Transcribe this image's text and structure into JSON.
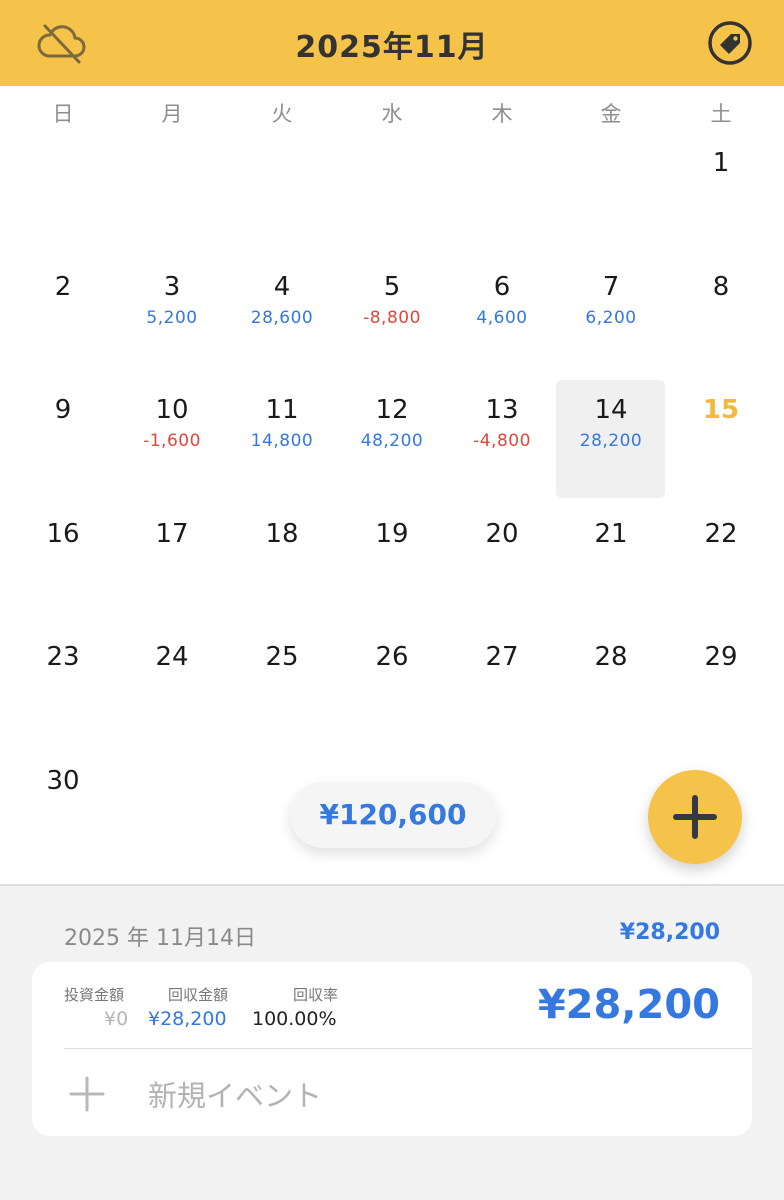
{
  "header": {
    "title": "2025年11月",
    "left_icon": "cloud-off-icon",
    "right_icon": "tag-icon"
  },
  "weekdays": [
    "日",
    "月",
    "火",
    "水",
    "木",
    "金",
    "土"
  ],
  "days": {
    "d1": {
      "num": "1",
      "amt": ""
    },
    "d2": {
      "num": "2",
      "amt": ""
    },
    "d3": {
      "num": "3",
      "amt": "5,200"
    },
    "d4": {
      "num": "4",
      "amt": "28,600"
    },
    "d5": {
      "num": "5",
      "amt": "-8,800"
    },
    "d6": {
      "num": "6",
      "amt": "4,600"
    },
    "d7": {
      "num": "7",
      "amt": "6,200"
    },
    "d8": {
      "num": "8",
      "amt": ""
    },
    "d9": {
      "num": "9",
      "amt": ""
    },
    "d10": {
      "num": "10",
      "amt": "-1,600"
    },
    "d11": {
      "num": "11",
      "amt": "14,800"
    },
    "d12": {
      "num": "12",
      "amt": "48,200"
    },
    "d13": {
      "num": "13",
      "amt": "-4,800"
    },
    "d14": {
      "num": "14",
      "amt": "28,200"
    },
    "d15": {
      "num": "15",
      "amt": ""
    },
    "d16": {
      "num": "16",
      "amt": ""
    },
    "d17": {
      "num": "17",
      "amt": ""
    },
    "d18": {
      "num": "18",
      "amt": ""
    },
    "d19": {
      "num": "19",
      "amt": ""
    },
    "d20": {
      "num": "20",
      "amt": ""
    },
    "d21": {
      "num": "21",
      "amt": ""
    },
    "d22": {
      "num": "22",
      "amt": ""
    },
    "d23": {
      "num": "23",
      "amt": ""
    },
    "d24": {
      "num": "24",
      "amt": ""
    },
    "d25": {
      "num": "25",
      "amt": ""
    },
    "d26": {
      "num": "26",
      "amt": ""
    },
    "d27": {
      "num": "27",
      "amt": ""
    },
    "d28": {
      "num": "28",
      "amt": ""
    },
    "d29": {
      "num": "29",
      "amt": ""
    },
    "d30": {
      "num": "30",
      "amt": ""
    }
  },
  "month_total": "¥120,600",
  "fab_icon": "plus-icon",
  "detail": {
    "date": "2025 年 11月14日",
    "total": "¥28,200",
    "invest_label": "投資金額",
    "invest_value": "¥0",
    "return_label": "回収金額",
    "return_value": "¥28,200",
    "rate_label": "回収率",
    "rate_value": "100.00%",
    "big_amount": "¥28,200",
    "new_event_label": "新規イベント",
    "new_event_icon": "plus-icon"
  },
  "colors": {
    "accent": "#f5c24a",
    "positive": "#3478e0",
    "negative": "#e2463c",
    "today": "#f3b93c"
  }
}
